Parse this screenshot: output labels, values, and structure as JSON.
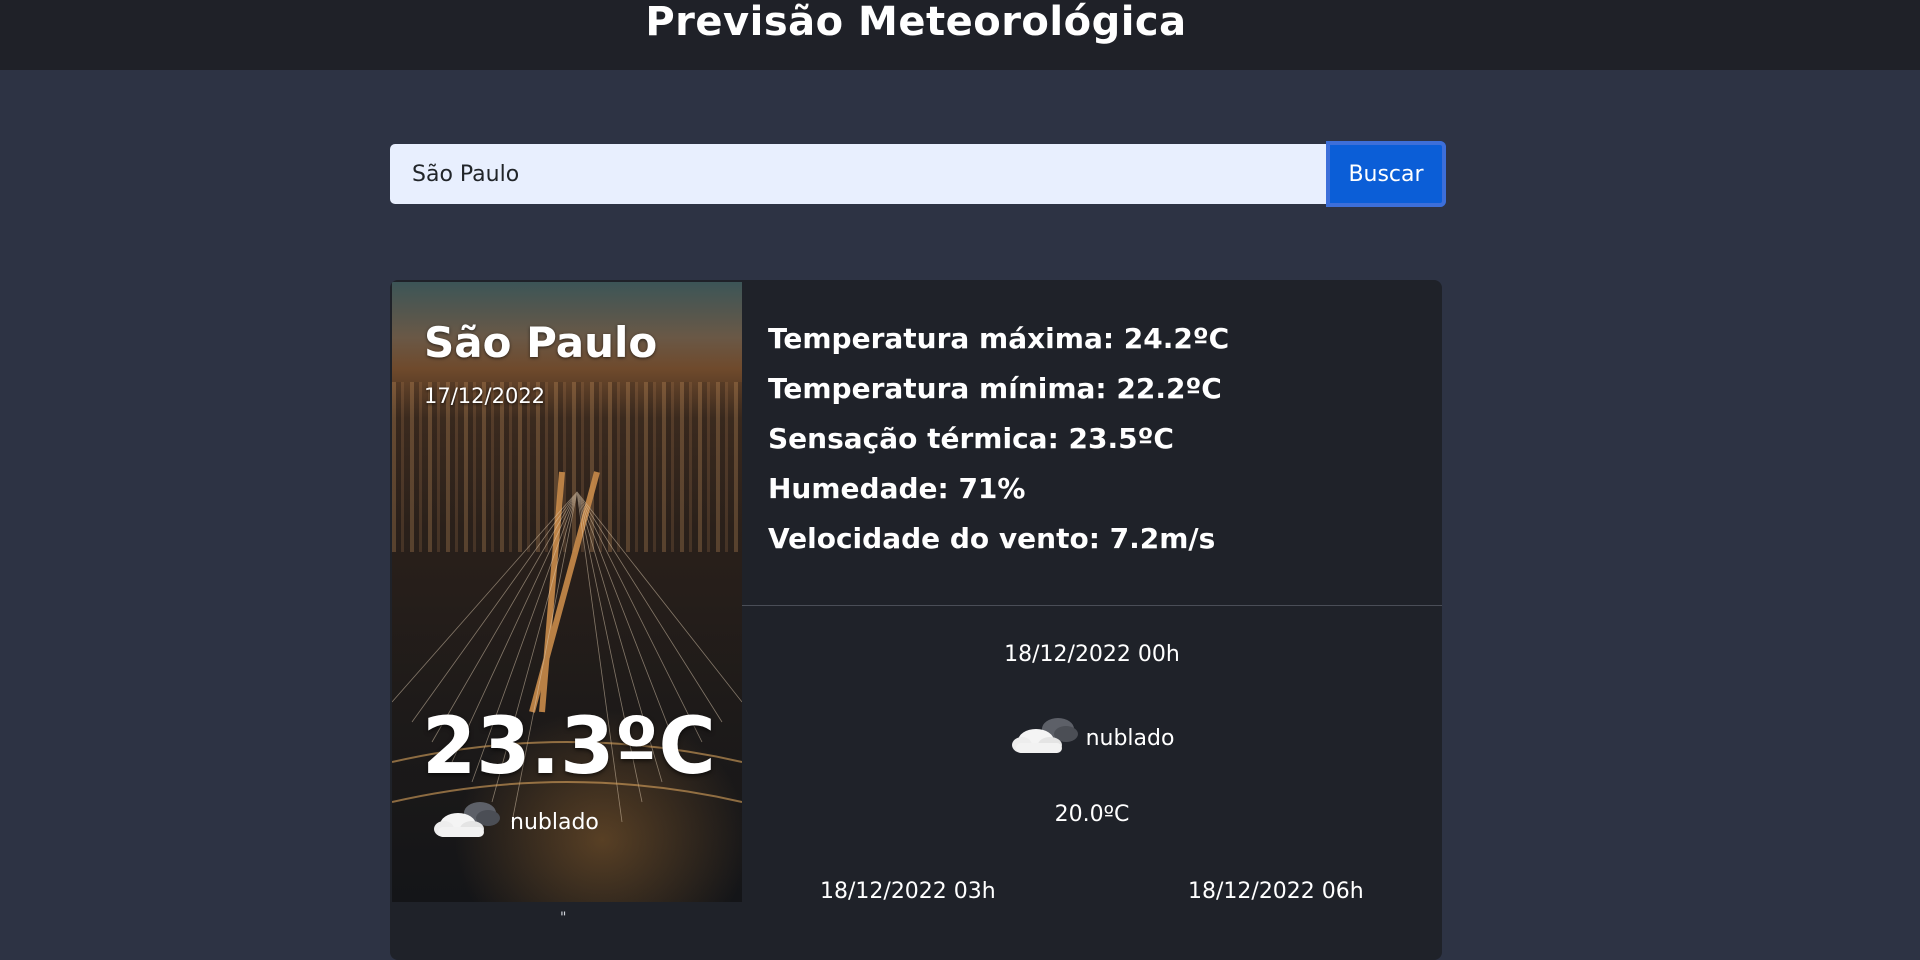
{
  "header": {
    "title": "Previsão Meteorológica"
  },
  "search": {
    "value": "São Paulo",
    "button_label": "Buscar"
  },
  "current": {
    "city": "São Paulo",
    "date": "17/12/2022",
    "temperature": "23.3ºC",
    "condition": "nublado",
    "condition_icon": "cloud-icon",
    "caption": "\""
  },
  "details": {
    "max_temp": "Temperatura máxima: 24.2ºC",
    "min_temp": "Temperatura mínima: 22.2ºC",
    "feels_like": "Sensação térmica: 23.5ºC",
    "humidity": "Humedade: 71%",
    "wind": "Velocidade do vento: 7.2m/s"
  },
  "forecast": [
    {
      "datetime": "18/12/2022 00h",
      "condition": "nublado",
      "temperature": "20.0ºC"
    },
    {
      "datetime": "18/12/2022 03h"
    },
    {
      "datetime": "18/12/2022 06h"
    }
  ],
  "colors": {
    "background": "#2d3344",
    "header": "#1f2128",
    "card": "#1f2229",
    "input_bg": "#e8effe",
    "accent": "#0b5ed7"
  }
}
